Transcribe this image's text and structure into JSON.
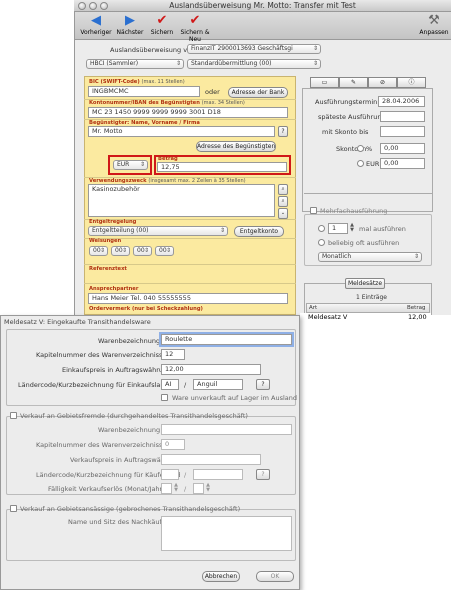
{
  "window": {
    "title": "Auslandsüberweisung Mr. Motto: Transfer mit Test"
  },
  "toolbar": {
    "prev": "Vorheriger",
    "next": "Nächster",
    "save": "Sichern",
    "save_new": "Sichern & Neu",
    "customize": "Anpassen"
  },
  "header": {
    "type_label": "Auslandsüberweisung von",
    "account": "FinanzIT 2900013693 Geschäftsgi",
    "hbci": "HBCI (Sammler)",
    "transfer_type": "Standardübermittlung (00)"
  },
  "form": {
    "bic_label": "BIC (SWIFT-Code)",
    "bic_hint": "(max. 11 Stellen)",
    "bic_value": "INGBMCMC",
    "oder": "oder",
    "bank_address_btn": "Adresse der Bank",
    "iban_label": "Kontonummer/IBAN des Begünstigten",
    "iban_hint": "(max. 34 Stellen)",
    "iban_value": "MC 23 1450 9999 9999 9999 3001 D18",
    "beneficiary_label": "Begünstigter: Name, Vorname / Firma",
    "beneficiary_value": "Mr. Motto",
    "question": "?",
    "beneficiary_address_btn": "Adresse des Begünstigten",
    "currency": "EUR",
    "amount_label": "Betrag",
    "amount_value": "12,75",
    "purpose_label": "Verwendungszweck",
    "purpose_hint": "(insgesamt max. 2 Zeilen à 35 Stellen)",
    "purpose_value": "Kasinozubehör",
    "fee_label": "Entgeltregelung",
    "fee_value": "Entgeltteilung (00)",
    "fee_account_btn": "Entgeltkonto",
    "instructions_label": "Weisungen",
    "instructions": [
      "00",
      "00",
      "00",
      "00"
    ],
    "reference_label": "Referenztext",
    "contact_label": "Ansprechpartner",
    "contact_value": "Hans Meier Tel. 040 55555555",
    "order_note": "Ordervermerk (nur bei Scheckzahlung)"
  },
  "right": {
    "tabs": [
      "▭",
      "✎",
      "⊘",
      "ⓘ"
    ],
    "exec_date_label": "Ausführungstermin",
    "exec_date": "28.04.2006",
    "latest_label": "späteste Ausführung",
    "skonto_until_label": "mit Skonto bis",
    "skonto_in_label": "Skonto in",
    "percent": "%",
    "eur": "EUR",
    "percent_value": "0,00",
    "eur_value": "0,00",
    "multi_label": "Mehrfachausführung",
    "times_value": "1",
    "times_label": "mal ausführen",
    "anytime_label": "beliebig oft ausführen",
    "interval": "Monatlich"
  },
  "meldesaetze": {
    "tab": "Meldesätze",
    "count": "1 Einträge",
    "col_art": "Art",
    "col_betrag": "Betrag",
    "row_type": "Meldesatz V",
    "row_amount": "12,00"
  },
  "sheet": {
    "title": "Meldesatz V: Eingekaufte Transithandelsware",
    "goods_label": "Warenbezeichnung",
    "goods_value": "Roulette",
    "chapter_label": "Kapitelnummer des Warenverzeichnisses",
    "chapter_value": "12",
    "price_label": "Einkaufspreis in Auftragswährung",
    "price_value": "12,00",
    "country_label": "Ländercode/Kurzbezeichnung für Einkaufsland",
    "country_code": "AI",
    "slash": "/",
    "country_name": "Anguil",
    "q": "?",
    "stock_label": "Ware unverkauft auf Lager im Ausland",
    "sect2_label": "Verkauf an Gebietsfremde (durchgehandeltes Transithandelsgeschäft)",
    "s2_goods": "Warenbezeichnung",
    "s2_chapter": "Kapitelnummer des Warenverzeichnisses",
    "s2_chapter_value": "0",
    "s2_price": "Verkaufspreis in Auftragswährung",
    "s2_country": "Ländercode/Kurzbezeichnung für Käuferland",
    "s2_due": "Fälligkeit Verkaufserlös (Monat/Jahr)",
    "sect3_label": "Verkauf an Gebietsansässige (gebrochenes Transithandelsgeschäft)",
    "s3_name": "Name und Sitz des Nachkäufers",
    "cancel": "Abbrechen",
    "ok": "OK"
  }
}
